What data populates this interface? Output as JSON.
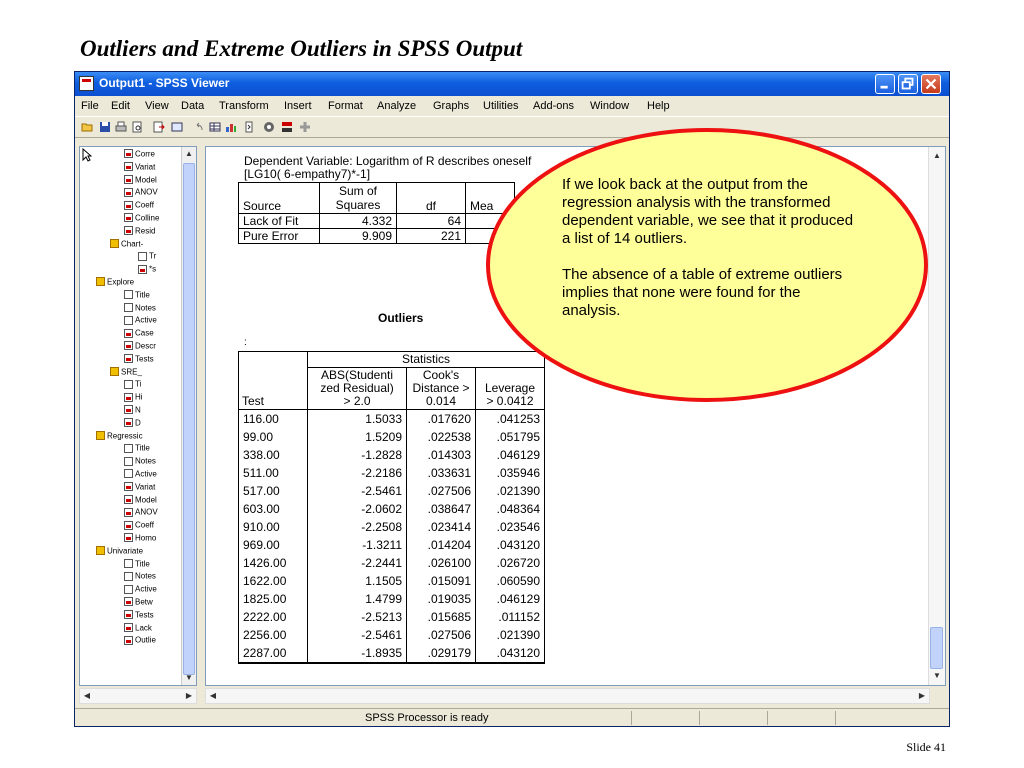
{
  "slide": {
    "title": "Outliers and Extreme Outliers in SPSS Output",
    "number": "Slide 41"
  },
  "window": {
    "title": "Output1 - SPSS Viewer",
    "menu": [
      "File",
      "Edit",
      "View",
      "Data",
      "Transform",
      "Insert",
      "Format",
      "Analyze",
      "Graphs",
      "Utilities",
      "Add-ons",
      "Window",
      "Help"
    ],
    "status": "SPSS Processor is ready"
  },
  "outline": {
    "items": [
      {
        "label": "Corre",
        "icon": "chart"
      },
      {
        "label": "Variat",
        "icon": "chart"
      },
      {
        "label": "Model",
        "icon": "chart"
      },
      {
        "label": "ANOV",
        "icon": "chart"
      },
      {
        "label": "Coeff",
        "icon": "chart"
      },
      {
        "label": "Colline",
        "icon": "chart"
      },
      {
        "label": "Resid",
        "icon": "chart"
      },
      {
        "label": "Chart-",
        "icon": "book"
      },
      {
        "label": "Tr",
        "icon": "doc"
      },
      {
        "label": "*s",
        "icon": "chart"
      },
      {
        "label": "Explore",
        "icon": "book"
      },
      {
        "label": "Title",
        "icon": "doc"
      },
      {
        "label": "Notes",
        "icon": "doc"
      },
      {
        "label": "Active",
        "icon": "doc"
      },
      {
        "label": "Case",
        "icon": "chart"
      },
      {
        "label": "Descr",
        "icon": "chart"
      },
      {
        "label": "Tests",
        "icon": "chart"
      },
      {
        "label": "SRE_",
        "icon": "book"
      },
      {
        "label": "Ti",
        "icon": "doc"
      },
      {
        "label": "Hi",
        "icon": "chart"
      },
      {
        "label": "N",
        "icon": "chart"
      },
      {
        "label": "D",
        "icon": "chart"
      },
      {
        "label": "Regressic",
        "icon": "book"
      },
      {
        "label": "Title",
        "icon": "doc"
      },
      {
        "label": "Notes",
        "icon": "doc"
      },
      {
        "label": "Active",
        "icon": "doc"
      },
      {
        "label": "Variat",
        "icon": "chart"
      },
      {
        "label": "Model",
        "icon": "chart"
      },
      {
        "label": "ANOV",
        "icon": "chart"
      },
      {
        "label": "Coeff",
        "icon": "chart"
      },
      {
        "label": "Homo",
        "icon": "chart"
      },
      {
        "label": "Univariate",
        "icon": "book"
      },
      {
        "label": "Title",
        "icon": "doc"
      },
      {
        "label": "Notes",
        "icon": "doc"
      },
      {
        "label": "Active",
        "icon": "doc"
      },
      {
        "label": "Betw",
        "icon": "chart"
      },
      {
        "label": "Tests",
        "icon": "chart"
      },
      {
        "label": "Lack",
        "icon": "chart"
      },
      {
        "label": "Outlie",
        "icon": "chart"
      }
    ]
  },
  "output": {
    "dependent_line1": "Dependent Variable: Logarithm of R describes oneself",
    "dependent_line2": "[LG10( 6-empathy7)*-1]",
    "anova": {
      "headers": [
        "Source",
        "Sum of Squares",
        "df",
        "Mea"
      ],
      "rows": [
        {
          "source": "Lack of Fit",
          "ss": "4.332",
          "df": "64"
        },
        {
          "source": "Pure Error",
          "ss": "9.909",
          "df": "221"
        }
      ]
    },
    "outliers_title": "Outliers",
    "colon": ":",
    "outliers": {
      "group_header": "Statistics",
      "col_test": "Test",
      "col1": "ABS(Studentized Residual) > 2.0",
      "col1_a": "ABS(Studenti",
      "col1_b": "zed Residual)",
      "col1_c": "> 2.0",
      "col2_a": "Cook's",
      "col2_b": "Distance >",
      "col2_c": "0.014",
      "col3_a": "Leverage",
      "col3_b": "> 0.0412",
      "rows": [
        [
          "116.00",
          "1.5033",
          ".017620",
          ".041253"
        ],
        [
          "99.00",
          "1.5209",
          ".022538",
          ".051795"
        ],
        [
          "338.00",
          "-1.2828",
          ".014303",
          ".046129"
        ],
        [
          "511.00",
          "-2.2186",
          ".033631",
          ".035946"
        ],
        [
          "517.00",
          "-2.5461",
          ".027506",
          ".021390"
        ],
        [
          "603.00",
          "-2.0602",
          ".038647",
          ".048364"
        ],
        [
          "910.00",
          "-2.2508",
          ".023414",
          ".023546"
        ],
        [
          "969.00",
          "-1.3211",
          ".014204",
          ".043120"
        ],
        [
          "1426.00",
          "-2.2441",
          ".026100",
          ".026720"
        ],
        [
          "1622.00",
          "1.1505",
          ".015091",
          ".060590"
        ],
        [
          "1825.00",
          "1.4799",
          ".019035",
          ".046129"
        ],
        [
          "2222.00",
          "-2.5213",
          ".015685",
          ".011152"
        ],
        [
          "2256.00",
          "-2.5461",
          ".027506",
          ".021390"
        ],
        [
          "2287.00",
          "-1.8935",
          ".029179",
          ".043120"
        ]
      ]
    }
  },
  "callout": {
    "para1": "If we look back at the output from the regression analysis with the transformed dependent variable, we see that it  produced a list of 14 outliers.",
    "para2": "The absence of a table of extreme outliers implies that none were found for the analysis.",
    "fill": "#ffff99",
    "stroke": "#ee1111"
  }
}
